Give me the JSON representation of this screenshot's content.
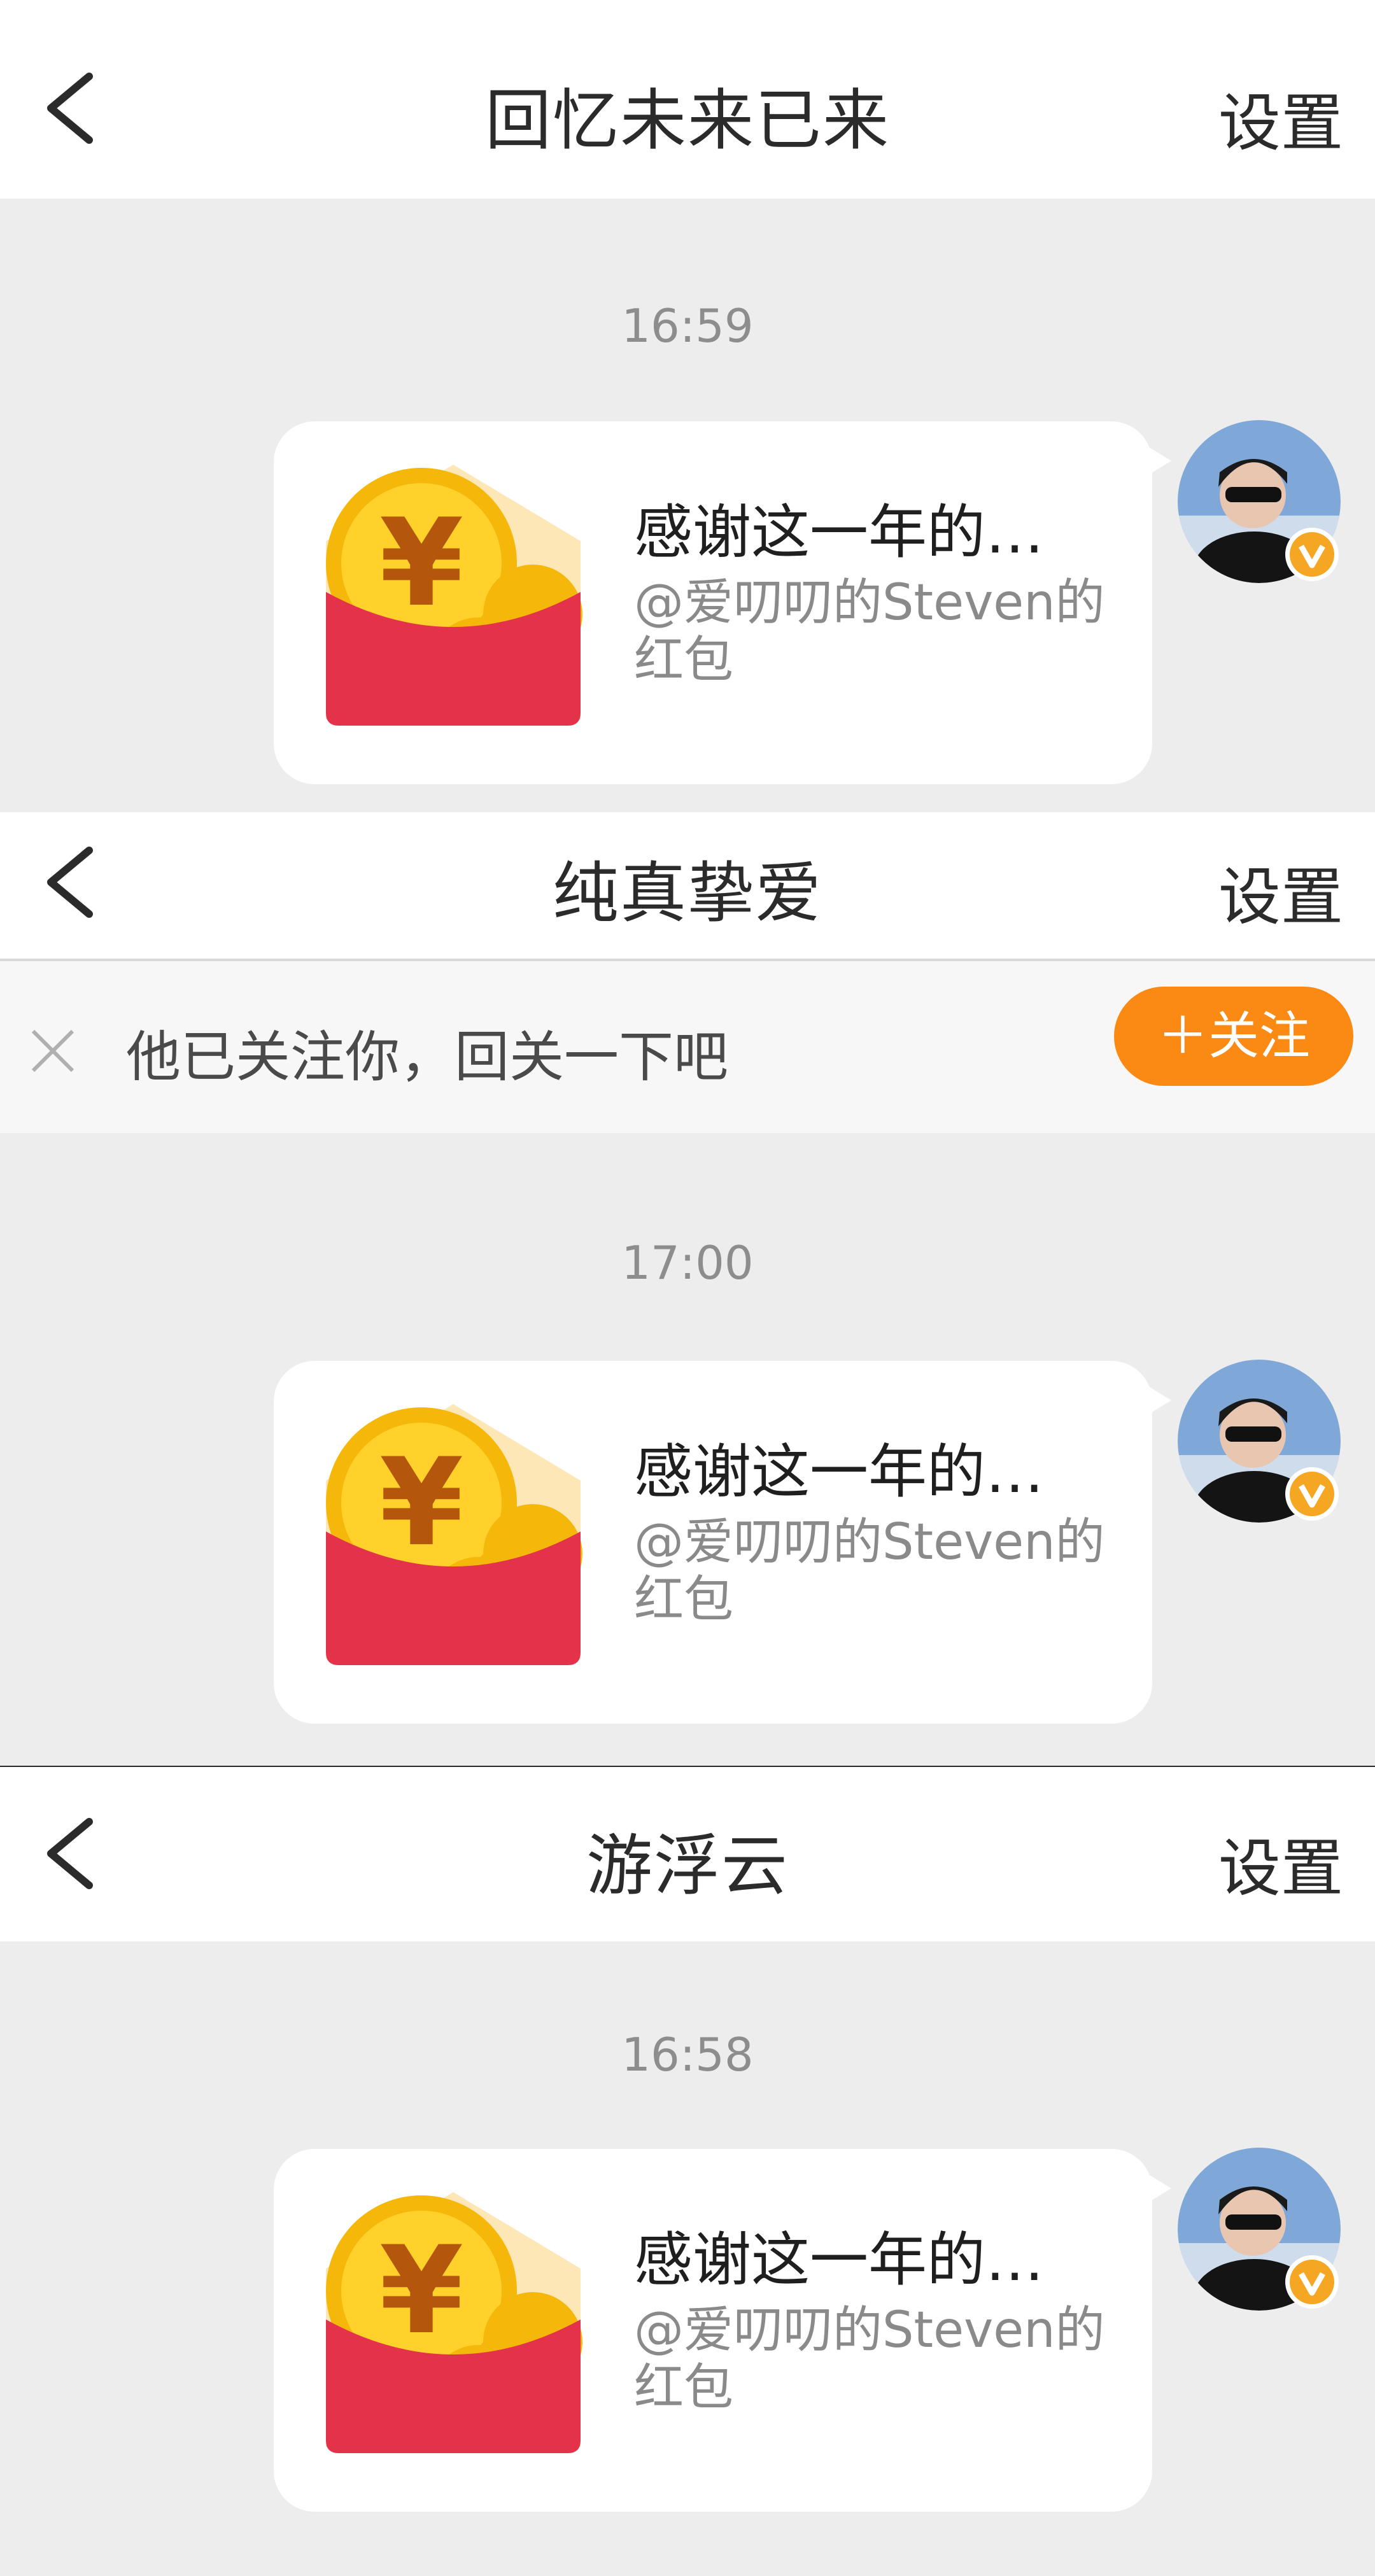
{
  "chats": [
    {
      "title": "回忆未来已来",
      "settings_label": "设置",
      "time": "16:59",
      "message": {
        "title": "感谢这一年的…",
        "desc": "@爱叨叨的Steven的红包"
      }
    },
    {
      "title": "纯真挚爱",
      "settings_label": "设置",
      "follow_bar": {
        "text": "他已关注你，回关一下吧",
        "button_label": "＋关注"
      },
      "time": "17:00",
      "message": {
        "title": "感谢这一年的…",
        "desc": "@爱叨叨的Steven的红包"
      }
    },
    {
      "title": "游浮云",
      "settings_label": "设置",
      "time": "16:58",
      "message": {
        "title": "感谢这一年的…",
        "desc": "@爱叨叨的Steven的红包"
      }
    }
  ],
  "colors": {
    "background": "#ededed",
    "header": "#ffffff",
    "follow_button": "#fb8a14",
    "red_packet": "#e4324a",
    "coin": "#f5b80a",
    "verified_badge": "#f5a623"
  },
  "icons": [
    "back-icon",
    "close-icon",
    "red-packet-icon",
    "avatar",
    "verified-badge-icon"
  ]
}
